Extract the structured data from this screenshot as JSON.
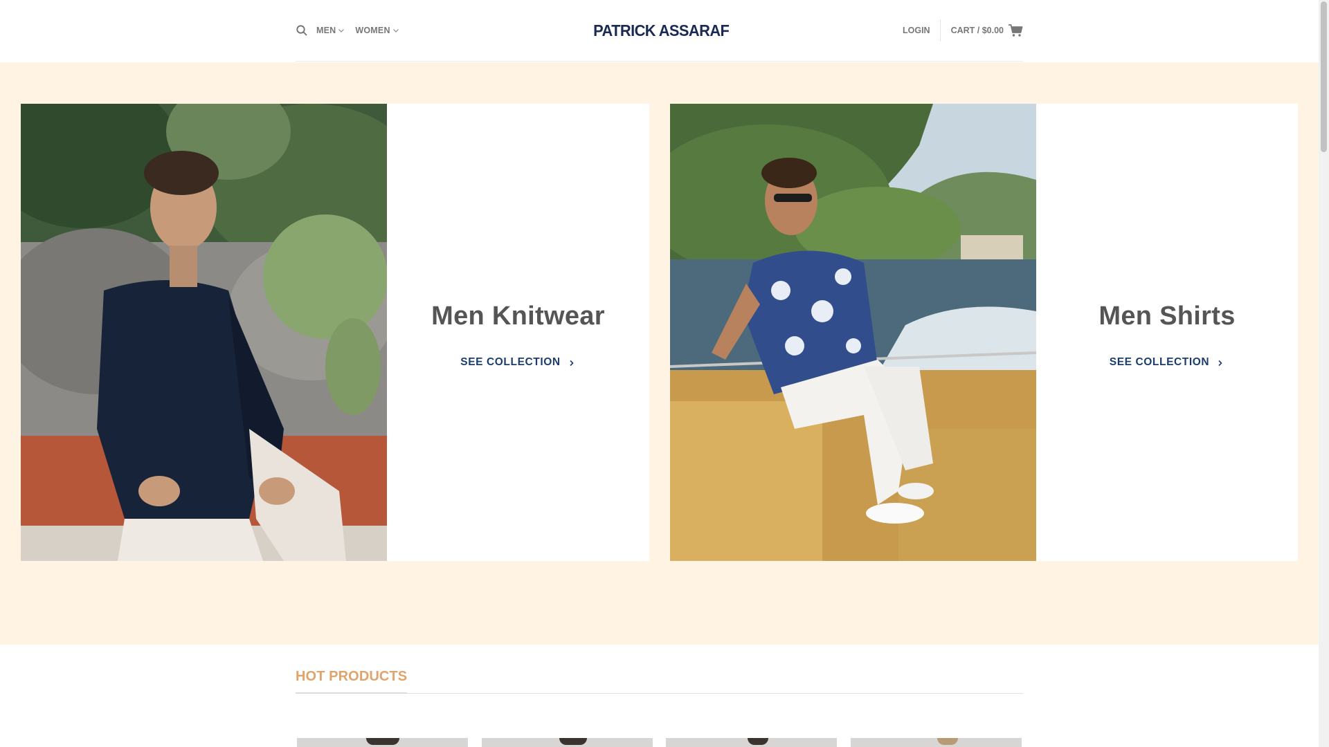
{
  "header": {
    "logo_text": "PATRICK ASSARAF",
    "nav_left": [
      {
        "label": "MEN"
      },
      {
        "label": "WOMEN"
      }
    ],
    "login_label": "LOGIN",
    "cart_label": "CART / $0.00",
    "icons": {
      "search": "search-icon",
      "cart": "shopping-cart-icon",
      "dropdown": "chevron-down-icon"
    }
  },
  "hero": {
    "background_color": "#fff4e3",
    "banners": [
      {
        "title": "Men Knitwear",
        "cta": "SEE COLLECTION",
        "image": "man-in-navy-cable-knit-cardigan-photo"
      },
      {
        "title": "Men Shirts",
        "cta": "SEE COLLECTION",
        "image": "man-in-floral-shirt-on-boat-photo"
      }
    ]
  },
  "products": {
    "section_title": "HOT PRODUCTS",
    "title_color": "#e0a36c",
    "item_count_visible": 4
  },
  "colors": {
    "brand_navy": "#1b2a55",
    "cta_blue": "#1b3d6e",
    "nav_gray": "#777777",
    "title_gray": "#555555"
  }
}
